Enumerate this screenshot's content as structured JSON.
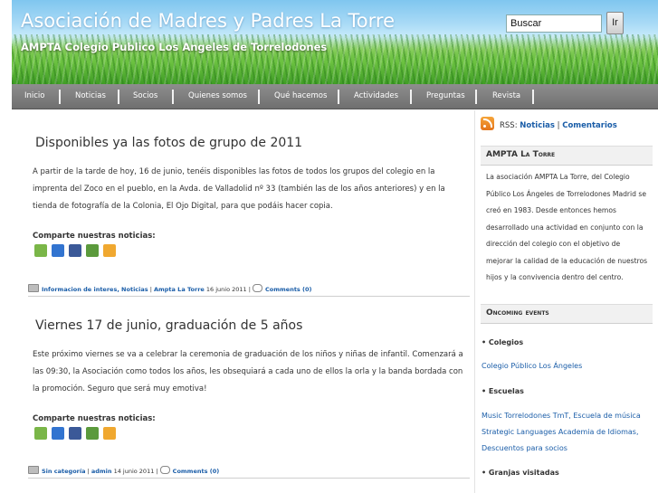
{
  "header": {
    "title": "Asociación de Madres y Padres La Torre",
    "subtitle": "AMPTA Colegio Publico Los Angeles de Torrelodones",
    "search_value": "Buscar",
    "search_button": "Ir"
  },
  "nav": {
    "items": [
      "Inicio",
      "Noticias",
      "Socios",
      "Quienes somos",
      "Qué hacemos",
      "Actividades",
      "Preguntas",
      "Revista"
    ]
  },
  "posts": [
    {
      "title": "Disponibles ya las fotos de grupo de 2011",
      "body": "A partir de la tarde de hoy, 16 de junio, tenéis disponibles las fotos de todos los grupos del colegio en la imprenta del Zoco  en el pueblo, en la Avda. de Valladolid nº 33 (también las de los años anteriores) y en la tienda de fotografía de la Colonia, El Ojo Digital, para que podáis hacer copia.",
      "share_label": "Comparte nuestras noticias:",
      "categories": "Informacion de interes, Noticias",
      "sep1": " | ",
      "author": "Ampta La Torre",
      "date": " 16 junio 2011",
      "sep2": " | ",
      "comments": "Comments (0)"
    },
    {
      "title": "Viernes 17 de junio, graduación de 5 años",
      "body": "Este próximo viernes se va a celebrar la ceremonia de graduación de los niños y niñas de infantil. Comenzará a las 09:30, la Asociación como todos los años, les obsequiará a cada uno de ellos la orla y la banda bordada con la promoción. Seguro que será muy emotiva!",
      "share_label": "Comparte nuestras noticias:",
      "categories": "Sin categoría",
      "sep1": " | ",
      "author": "admin",
      "date": " 14 junio 2011",
      "sep2": " | ",
      "comments": "Comments (0)"
    }
  ],
  "share_icons": [
    "print-icon",
    "delicious-icon",
    "facebook-icon",
    "google-icon",
    "live-icon"
  ],
  "share_colors": [
    "#7ab648",
    "#3274d0",
    "#3b5998",
    "#5b9a3c",
    "#f0a830"
  ],
  "sidebar": {
    "rss_label": "RSS: ",
    "rss_noticias": "Noticias",
    "rss_sep": " | ",
    "rss_comentarios": "Comentarios",
    "about_title_main": "AMPTA ",
    "about_title_sc": "La Torre",
    "about_text": "La asociación AMPTA La Torre, del Colegio Público Los Ángeles de Torrelodones Madrid se creó en 1983. Desde entonces hemos desarrollado una actividad en conjunto con la dirección del colegio con el objetivo de mejorar la calidad de la educación de nuestros hijos y la convivencia dentro del centro.",
    "events_title": "Oncoming events",
    "cat_colegios": "• Colegios",
    "link_colegio": "Colegio Público Los Ángeles",
    "cat_escuelas": "• Escuelas",
    "link_music": "Music Torrelodones TmT, Escuela de música",
    "link_strategic": "Strategic Languages Academia de Idiomas,",
    "link_descuentos": "Descuentos para socios",
    "cat_granjas": "• Granjas visitadas"
  }
}
